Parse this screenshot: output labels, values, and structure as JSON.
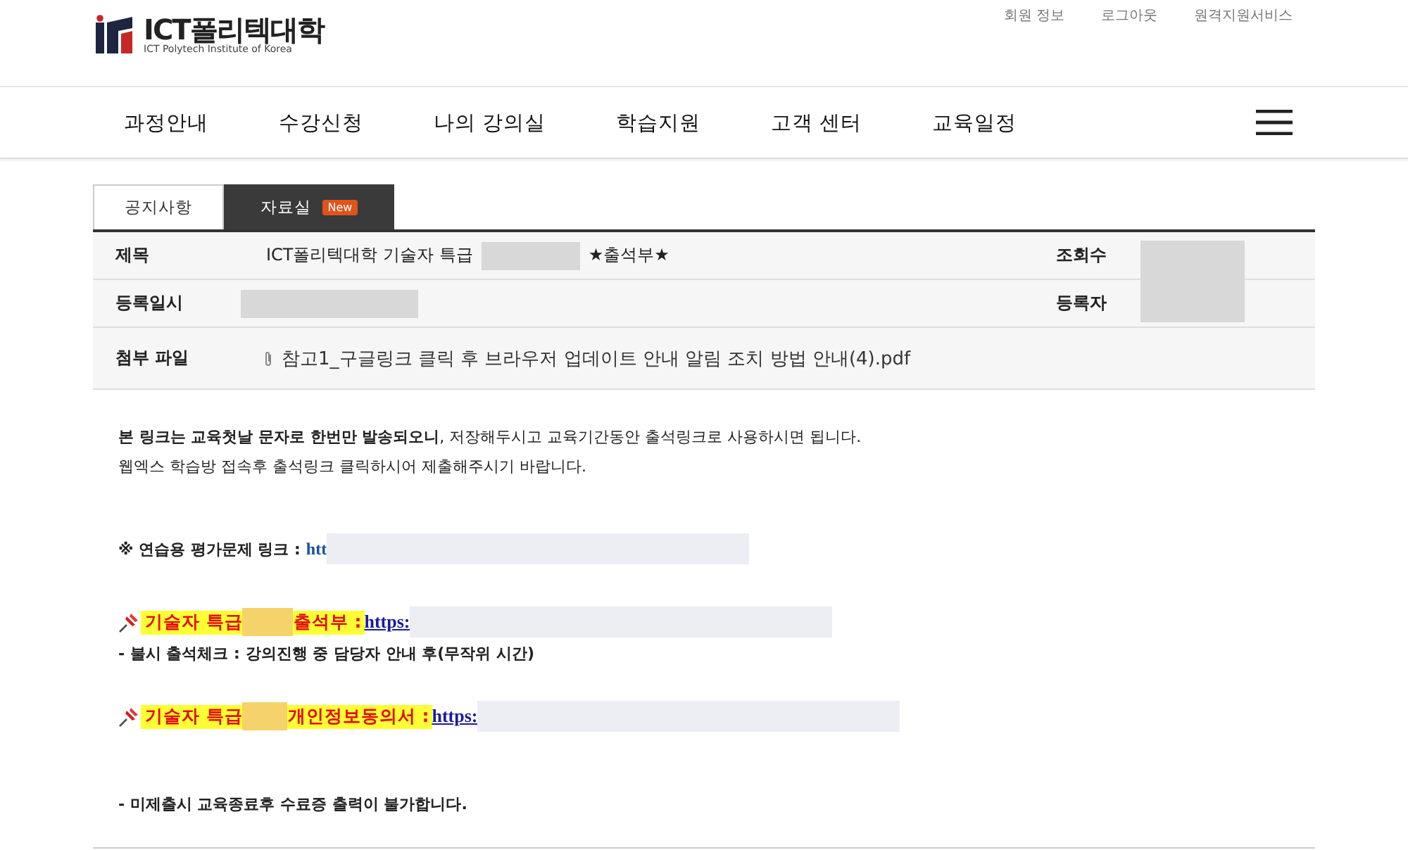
{
  "header": {
    "logo_title": "ICT폴리텍대학",
    "logo_subtitle": "ICT Polytech Institute of Korea",
    "util_links": [
      "회원 정보",
      "로그아웃",
      "원격지원서비스"
    ]
  },
  "nav": {
    "items": [
      "과정안내",
      "수강신청",
      "나의 강의실",
      "학습지원",
      "고객 센터",
      "교육일정"
    ]
  },
  "tabs": [
    {
      "label": "공지사항",
      "selected": false
    },
    {
      "label": "자료실",
      "selected": true,
      "badge": "New"
    }
  ],
  "post": {
    "title_label": "제목",
    "title_before": "ICT폴리텍대학 기술자 특급",
    "title_after": "★출석부★",
    "views_label": "조회수",
    "date_label": "등록일시",
    "author_label": "등록자",
    "attachment_label": "첨부 파일",
    "attachment": "참고1_구글링크 클릭 후 브라우저 업데이트 안내 알림 조치 방법 안내(4).pdf"
  },
  "body": {
    "intro": [
      "**본 링크는 교육첫날 문자로 한번만 발송되오니**, 저장해두시고 교육기간동안 출석링크로 사용하시면 됩니다.",
      "웹엑스 학습방 접속후 출석링크 클릭하시어 제출해주시기 바랍니다."
    ],
    "practice_label": "※ 연습용 평가문제 링크 :",
    "practice_link": "htt",
    "attendance": {
      "prefix": "기술자 특급",
      "suffix": "출석부 :",
      "link": "https:"
    },
    "attendance_note": "- 불시 출석체크 : 강의진행 중 담당자 안내 후(무작위 시간)",
    "consent": {
      "prefix": "기술자 특급",
      "suffix": "개인정보동의서 :",
      "link": "https:"
    },
    "final_note": "- 미제출시 교육종료후 수료증 출력이 불가합니다."
  }
}
